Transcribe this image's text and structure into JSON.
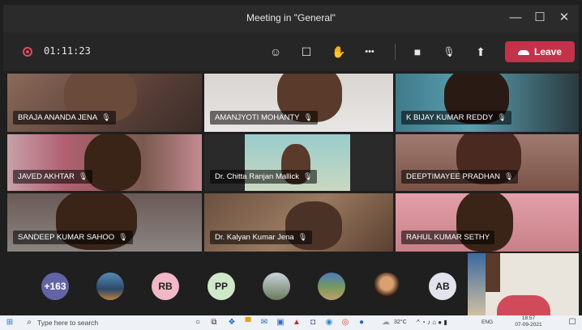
{
  "window": {
    "title": "Meeting in \"General\"",
    "minimize": "—",
    "maximize": "☐",
    "close": "✕"
  },
  "toolbar": {
    "timer": "01:11:23",
    "icons": [
      "participants-icon",
      "chat-icon",
      "raise-hand-icon",
      "more-options-icon",
      "camera-icon",
      "mic-muted-icon",
      "share-screen-icon"
    ],
    "glyphs": {
      "participants": "☺",
      "chat": "☐",
      "hand": "✋",
      "more": "•••",
      "camera": "■",
      "mic": "🎙",
      "share": "⬆"
    },
    "leave_label": "Leave",
    "leave_color": "#c4314b"
  },
  "participants": [
    {
      "name": "BRAJA ANANDA JENA"
    },
    {
      "name": "AMANJYOTI MOHANTY"
    },
    {
      "name": "K BIJAY KUMAR REDDY"
    },
    {
      "name": "JAVED AKHTAR"
    },
    {
      "name": "Dr. Chitta Ranjan Mallick"
    },
    {
      "name": "DEEPTIMAYEE PRADHAN"
    },
    {
      "name": "SANDEEP KUMAR SAHOO"
    },
    {
      "name": "Dr. Kalyan Kumar Jena"
    },
    {
      "name": "RAHUL KUMAR SETHY"
    }
  ],
  "mic_glyph": "🎙",
  "strip": {
    "overflow_count": "+163",
    "avatars": [
      {
        "initials": "",
        "color": "#3a6ea5"
      },
      {
        "initials": "RB",
        "color": "#f2b8c6"
      },
      {
        "initials": "PP",
        "color": "#cfe8c9"
      },
      {
        "initials": "",
        "color": "#8aa0b4"
      },
      {
        "initials": "",
        "color": "#6a8d5a"
      },
      {
        "initials": "",
        "color": "#d9a070"
      },
      {
        "initials": "AB",
        "color": "#e3e3ee"
      }
    ]
  },
  "taskbar": {
    "search_placeholder": "Type here to search",
    "weather": "32°C",
    "lang": "ENG",
    "time": "18:57",
    "date": "07-09-2021"
  }
}
